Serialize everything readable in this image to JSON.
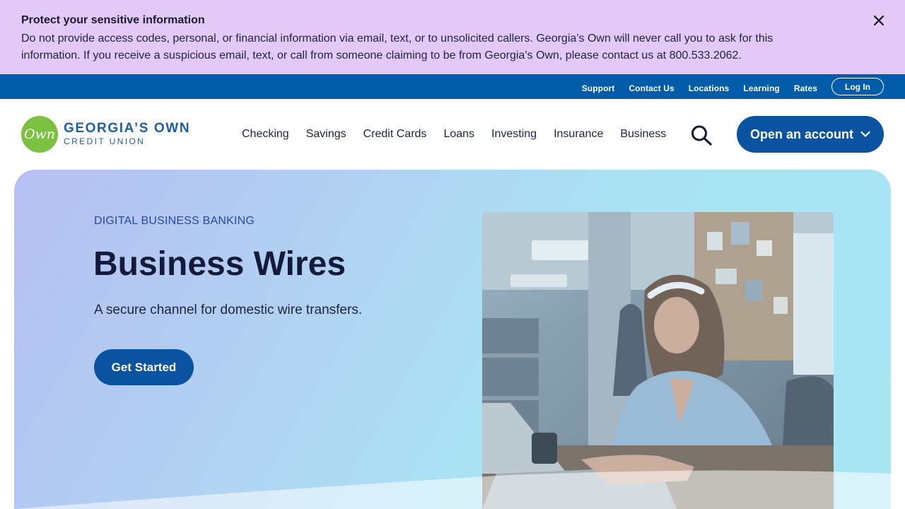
{
  "alert": {
    "title": "Protect your sensitive information",
    "body": "Do not provide access codes, personal, or financial information via email, text, or to unsolicited callers. Georgia’s Own will never call you to ask for this information. If you receive a suspicious email, text, or call from someone claiming to be from Georgia’s Own, please contact us at 800.533.2062.",
    "close_icon": "close-icon"
  },
  "utility": {
    "links": [
      "Support",
      "Contact Us",
      "Locations",
      "Learning",
      "Rates"
    ],
    "login": "Log In"
  },
  "brand": {
    "logo_mark": "Own",
    "name_line1": "GEORGIA’S OWN",
    "name_line2": "CREDIT UNION"
  },
  "nav": {
    "items": [
      "Checking",
      "Savings",
      "Credit Cards",
      "Loans",
      "Investing",
      "Insurance",
      "Business"
    ],
    "search_icon": "search-icon",
    "open_account": "Open an account"
  },
  "hero": {
    "eyebrow": "DIGITAL BUSINESS BANKING",
    "title": "Business Wires",
    "subtitle": "A secure channel for domestic wire transfers.",
    "cta": "Get Started"
  },
  "colors": {
    "alert_bg": "#e3c9f8",
    "utility_bg": "#005ba8",
    "brand_blue": "#0a53a0",
    "logo_green": "#7cc142"
  }
}
